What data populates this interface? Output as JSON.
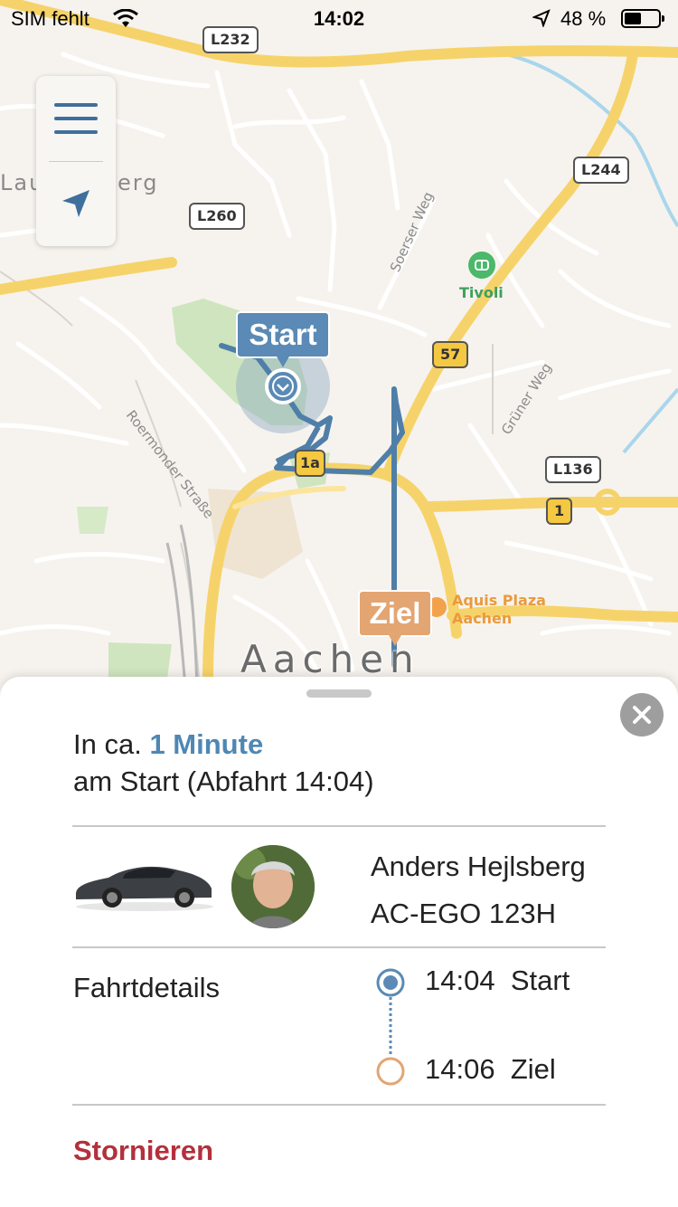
{
  "status_bar": {
    "carrier": "SIM fehlt",
    "time": "14:02",
    "battery_percent": "48 %"
  },
  "map": {
    "controls": {
      "menu_icon": "hamburger-menu-icon",
      "locate_icon": "location-arrow-icon"
    },
    "place_labels": {
      "lauren_left": "Lau",
      "lauren_right": "erg"
    },
    "city_label": "Aachen",
    "poi": {
      "tivoli": "Tivoli",
      "aquis_line1": "Aquis Plaza",
      "aquis_line2": "Aachen"
    },
    "street_labels": {
      "roermonder": "Roermonder Straße",
      "soerser": "Soerser Weg",
      "gruener": "Grüner Weg"
    },
    "shields": {
      "l232": "L232",
      "l244": "L244",
      "l260": "L260",
      "b57": "57",
      "l136": "L136",
      "b1": "1",
      "b1a": "1a"
    },
    "markers": {
      "start": "Start",
      "ziel": "Ziel"
    },
    "colors": {
      "route": "#4f7fa8",
      "start": "#5a8ab5",
      "ziel": "#e3a572",
      "road_yellow": "#f6d36a"
    }
  },
  "sheet": {
    "eta_prefix": "In ca.",
    "eta_value": "1 Minute",
    "eta_line2": "am Start (Abfahrt 14:04)",
    "driver_name": "Anders Hejlsberg",
    "license_plate": "AC-EGO 123H",
    "details_label": "Fahrtdetails",
    "stops": [
      {
        "time": "14:04",
        "label": "Start",
        "color": "#5a8ab5"
      },
      {
        "time": "14:06",
        "label": "Ziel",
        "color": "#e3a572"
      }
    ],
    "cancel_label": "Stornieren",
    "accent_color": "#4e87b4",
    "cancel_color": "#b3303c"
  }
}
